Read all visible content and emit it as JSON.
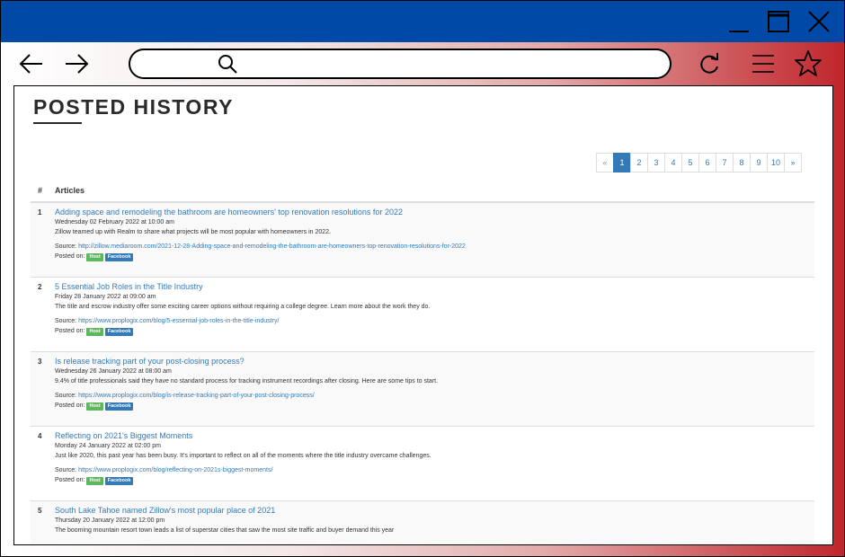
{
  "window": {
    "minimize_icon": "minimize-icon",
    "maximize_icon": "maximize-icon",
    "close_icon": "close-icon"
  },
  "toolbar": {
    "back_icon": "arrow-left-icon",
    "forward_icon": "arrow-right-icon",
    "search_icon": "search-icon",
    "reload_icon": "reload-icon",
    "menu_icon": "hamburger-menu-icon",
    "favorite_icon": "star-icon"
  },
  "page": {
    "title": "POSTED HISTORY"
  },
  "pagination": [
    "«",
    "1",
    "2",
    "3",
    "4",
    "5",
    "6",
    "7",
    "8",
    "9",
    "10",
    "»"
  ],
  "pagination_active": "1",
  "table": {
    "col_num": "#",
    "col_articles": "Articles"
  },
  "posted_on_label": "Posted on:",
  "source_label": "Source:",
  "articles": [
    {
      "num": "1",
      "title": "Adding space and remodeling the bathroom are homeowners' top renovation resolutions for 2022",
      "date": "Wednesday 02 February 2022 at 10:00 am",
      "summary": "Zillow teamed up with Realm to share what projects will be most popular with homeowners in 2022.",
      "source": "http://zillow.mediaroom.com/2021-12-28-Adding-space-and-remodeling-the-bathroom-are-homeowners-top-renovation-resolutions-for-2022",
      "badges": [
        "Host",
        "Facebook"
      ]
    },
    {
      "num": "2",
      "title": "5 Essential Job Roles in the Title Industry",
      "date": "Friday 28 January 2022 at 09:00 am",
      "summary": "The title and escrow industry offer some exciting career options without requiring a college degree. Learn more about the work they do.",
      "source": "https://www.proplogix.com/blog/5-essential-job-roles-in-the-title-industry/",
      "badges": [
        "Host",
        "Facebook"
      ]
    },
    {
      "num": "3",
      "title": "Is release tracking part of your post-closing process?",
      "date": "Wednesday 26 January 2022 at 08:00 am",
      "summary": "9.4% of title professionals said they have no standard process for tracking instrument recordings after closing. Here are some tips to start.",
      "source": "https://www.proplogix.com/blog/is-release-tracking-part-of-your-post-closing-process/",
      "badges": [
        "Host",
        "Facebook"
      ]
    },
    {
      "num": "4",
      "title": "Reflecting on 2021's Biggest Moments",
      "date": "Monday 24 January 2022 at 02:00 pm",
      "summary": "Just like 2020, this past year has been busy. It's important to reflect on all of the moments where the title industry overcame challenges.",
      "source": "https://www.proplogix.com/blog/reflecting-on-2021s-biggest-moments/",
      "badges": [
        "Host",
        "Facebook"
      ]
    },
    {
      "num": "5",
      "title": "South Lake Tahoe named Zillow's most popular place of 2021",
      "date": "Thursday 20 January 2022 at 12:00 pm",
      "summary": "The booming mountain resort town leads a list of superstar cities that saw the most site traffic and buyer demand this year",
      "source": "",
      "badges": []
    }
  ]
}
